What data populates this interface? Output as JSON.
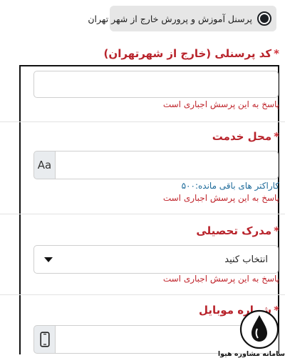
{
  "radio_option": {
    "label": "پرسنل آموزش و پرورش خارج از شهر تهران",
    "selected": true
  },
  "questions": [
    {
      "label": "کد پرسنلی (خارج از شهرتهران)",
      "required": true,
      "error": "پاسخ به این پرسش اجباری است"
    },
    {
      "label": "محل خدمت",
      "required": true,
      "addon": "Aa",
      "counter": "کاراکتر های باقی مانده:۵۰۰",
      "error": "پاسخ به این پرسش اجباری است"
    },
    {
      "label": "مدرک تحصیلی",
      "required": true,
      "select_value": "انتخاب کنید",
      "error": "پاسخ به این پرسش اجباری است"
    },
    {
      "label": "شماره موبایل",
      "required": true
    }
  ],
  "required_mark": "*",
  "watermark": {
    "text": "سامانه مشاوره هیوا"
  },
  "colors": {
    "label_red": "#b8232b",
    "error_red": "#c0262d",
    "counter_blue": "#1e6b9a",
    "pill_gray": "#e6e6e6"
  },
  "icons": {
    "addon_mobile": "mobile-phone-icon",
    "select_caret": "caret-down-icon",
    "logo": "ink-drop-logo-icon"
  }
}
